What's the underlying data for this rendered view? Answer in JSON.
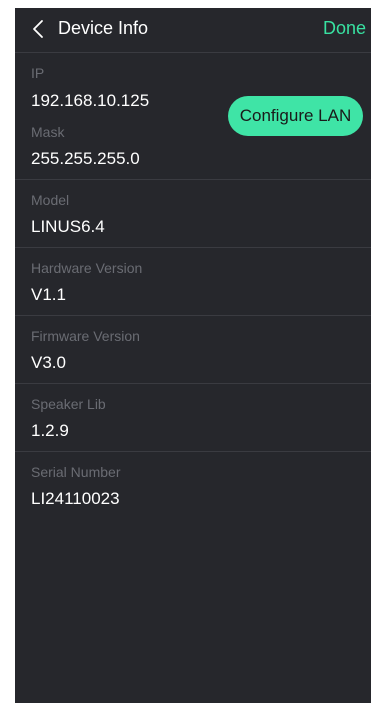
{
  "nav": {
    "back_icon": "chevron-left-icon",
    "title": "Device Info",
    "done_label": "Done"
  },
  "network": {
    "ip_label": "IP",
    "ip_value": "192.168.10.125",
    "mask_label": "Mask",
    "mask_value": "255.255.255.0",
    "configure_label": "Configure LAN"
  },
  "fields": [
    {
      "label": "Model",
      "value": "LINUS6.4"
    },
    {
      "label": "Hardware Version",
      "value": "V1.1"
    },
    {
      "label": "Firmware Version",
      "value": "V3.0"
    },
    {
      "label": "Speaker Lib",
      "value": "1.2.9"
    },
    {
      "label": "Serial Number",
      "value": "LI24110023"
    }
  ],
  "colors": {
    "background": "#26272c",
    "accent": "#3fe4a6",
    "label": "#6a6c73",
    "divider": "#3a3b41"
  }
}
